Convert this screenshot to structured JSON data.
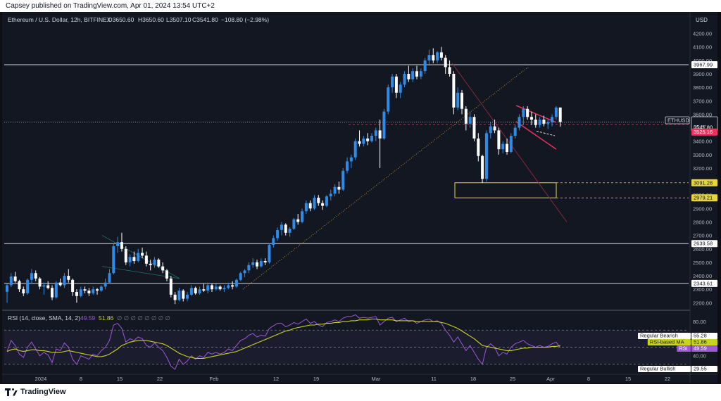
{
  "header": {
    "publisher": "Capsey published on TradingView.com, Apr 01, 2024 13:54 UTC+2"
  },
  "legend": {
    "symbol": "Ethereum / U.S. Dollar, 12h, BITFINEX",
    "open": "O3650.60",
    "high": "H3650.60",
    "low": "L3507.10",
    "close": "C3541.80",
    "change": "−108.80 (−2.98%)"
  },
  "price_axis": {
    "currency": "USD",
    "ticks": [
      "4200.00",
      "4100.00",
      "4000.00",
      "3900.00",
      "3800.00",
      "3700.00",
      "3600.00",
      "3500.00",
      "3400.00",
      "3300.00",
      "3200.00",
      "3100.00",
      "3000.00",
      "2900.00",
      "2800.00",
      "2700.00",
      "2600.00",
      "2500.00",
      "2400.00",
      "2300.00",
      "2200.00"
    ]
  },
  "price_labels": {
    "resistance_top": "3967.99",
    "ticker": "ETHUSD",
    "last_price": "3541.80",
    "countdown": "05:27",
    "red_level": "3525.16",
    "box_top": "3091.28",
    "box_bottom": "2979.21",
    "support_mid": "2639.58",
    "support_low": "2343.61"
  },
  "rsi": {
    "legend_prefix": "RSI (14, close, SMA, 14, 2)",
    "rsi_value": "49.59",
    "ma_value": "51.86",
    "nulls": "∅ ∅ ∅ ∅ ∅ ∅ ∅ ∅",
    "ticks": [
      "80.00",
      "40.00"
    ],
    "labels": {
      "bearish_name": "Regular Bearish",
      "bearish_value": "55.28",
      "ma_name": "RSI-based MA",
      "ma_value": "51.86",
      "rsi_name": "RSI",
      "rsi_value": "49.59",
      "bullish_name": "Regular Bullish",
      "bullish_value": "29.55"
    }
  },
  "time_axis": {
    "ticks": [
      "2024",
      "8",
      "15",
      "22",
      "Feb",
      "12",
      "19",
      "Mar",
      "11",
      "18",
      "25",
      "Apr",
      "8",
      "15",
      "22"
    ]
  },
  "footer": {
    "brand": "TradingView"
  },
  "colors": {
    "bull": "#2f8be6",
    "bear": "#ffffff",
    "rsi_line": "#9b59d6",
    "rsi_ma": "#c9d31f",
    "box": "#e7d53c",
    "red": "#e8335f",
    "bg": "#131722"
  },
  "chart_data": [
    {
      "type": "candlestick",
      "title": "Ethereum / U.S. Dollar, 12h, BITFINEX",
      "ylim": [
        2160,
        4250
      ],
      "yticks": [
        4200,
        4100,
        4000,
        3900,
        3800,
        3700,
        3600,
        3500,
        3400,
        3300,
        3200,
        3100,
        3000,
        2900,
        2800,
        2700,
        2600,
        2500,
        2400,
        2300,
        2200
      ],
      "levels": [
        3967.99,
        2639.58,
        2343.61
      ],
      "last_price": 3541.8,
      "red_level": 3525.16,
      "zone": [
        2979.21,
        3091.28
      ],
      "x_ticks": [
        "2024",
        "8",
        "15",
        "22",
        "Feb",
        "12",
        "19",
        "Mar",
        "11",
        "18",
        "25",
        "Apr",
        "8",
        "15",
        "22"
      ],
      "candles": [
        [
          2281,
          2340,
          2200,
          2330
        ],
        [
          2330,
          2420,
          2315,
          2395
        ],
        [
          2395,
          2430,
          2350,
          2360
        ],
        [
          2360,
          2370,
          2280,
          2300
        ],
        [
          2300,
          2320,
          2250,
          2270
        ],
        [
          2270,
          2380,
          2260,
          2370
        ],
        [
          2370,
          2450,
          2340,
          2420
        ],
        [
          2420,
          2440,
          2360,
          2380
        ],
        [
          2380,
          2390,
          2300,
          2320
        ],
        [
          2320,
          2350,
          2260,
          2330
        ],
        [
          2330,
          2360,
          2300,
          2310
        ],
        [
          2310,
          2330,
          2220,
          2240
        ],
        [
          2240,
          2360,
          2230,
          2350
        ],
        [
          2350,
          2380,
          2320,
          2330
        ],
        [
          2330,
          2420,
          2310,
          2400
        ],
        [
          2400,
          2450,
          2350,
          2370
        ],
        [
          2370,
          2380,
          2250,
          2280
        ],
        [
          2280,
          2300,
          2200,
          2250
        ],
        [
          2250,
          2320,
          2240,
          2300
        ],
        [
          2300,
          2320,
          2270,
          2290
        ],
        [
          2290,
          2310,
          2250,
          2270
        ],
        [
          2270,
          2320,
          2260,
          2300
        ],
        [
          2300,
          2310,
          2260,
          2290
        ],
        [
          2290,
          2330,
          2280,
          2320
        ],
        [
          2320,
          2380,
          2300,
          2350
        ],
        [
          2350,
          2450,
          2340,
          2420
        ],
        [
          2420,
          2640,
          2410,
          2620
        ],
        [
          2620,
          2690,
          2570,
          2650
        ],
        [
          2650,
          2720,
          2580,
          2600
        ],
        [
          2600,
          2620,
          2480,
          2500
        ],
        [
          2500,
          2560,
          2470,
          2540
        ],
        [
          2540,
          2580,
          2490,
          2510
        ],
        [
          2510,
          2600,
          2500,
          2570
        ],
        [
          2570,
          2610,
          2530,
          2550
        ],
        [
          2550,
          2580,
          2470,
          2490
        ],
        [
          2490,
          2520,
          2440,
          2480
        ],
        [
          2480,
          2540,
          2460,
          2520
        ],
        [
          2520,
          2530,
          2460,
          2470
        ],
        [
          2470,
          2500,
          2420,
          2440
        ],
        [
          2440,
          2450,
          2360,
          2380
        ],
        [
          2380,
          2400,
          2240,
          2260
        ],
        [
          2260,
          2280,
          2190,
          2220
        ],
        [
          2220,
          2310,
          2210,
          2290
        ],
        [
          2290,
          2300,
          2210,
          2230
        ],
        [
          2230,
          2280,
          2210,
          2260
        ],
        [
          2260,
          2330,
          2250,
          2310
        ],
        [
          2310,
          2320,
          2260,
          2270
        ],
        [
          2270,
          2320,
          2260,
          2300
        ],
        [
          2300,
          2340,
          2280,
          2290
        ],
        [
          2290,
          2350,
          2270,
          2330
        ],
        [
          2330,
          2340,
          2280,
          2300
        ],
        [
          2300,
          2340,
          2290,
          2320
        ],
        [
          2320,
          2330,
          2290,
          2300
        ],
        [
          2300,
          2330,
          2280,
          2310
        ],
        [
          2310,
          2350,
          2300,
          2330
        ],
        [
          2330,
          2360,
          2300,
          2320
        ],
        [
          2320,
          2380,
          2310,
          2370
        ],
        [
          2370,
          2430,
          2360,
          2420
        ],
        [
          2420,
          2450,
          2390,
          2440
        ],
        [
          2440,
          2500,
          2420,
          2480
        ],
        [
          2480,
          2530,
          2460,
          2500
        ],
        [
          2500,
          2520,
          2450,
          2470
        ],
        [
          2470,
          2530,
          2460,
          2510
        ],
        [
          2510,
          2530,
          2480,
          2500
        ],
        [
          2500,
          2640,
          2490,
          2630
        ],
        [
          2630,
          2700,
          2610,
          2680
        ],
        [
          2680,
          2760,
          2660,
          2740
        ],
        [
          2740,
          2800,
          2700,
          2780
        ],
        [
          2780,
          2790,
          2700,
          2720
        ],
        [
          2720,
          2760,
          2690,
          2750
        ],
        [
          2750,
          2830,
          2740,
          2820
        ],
        [
          2820,
          2860,
          2780,
          2800
        ],
        [
          2800,
          2900,
          2790,
          2880
        ],
        [
          2880,
          2960,
          2860,
          2940
        ],
        [
          2940,
          2960,
          2880,
          2900
        ],
        [
          2900,
          3000,
          2890,
          2980
        ],
        [
          2980,
          3000,
          2920,
          2940
        ],
        [
          2940,
          2960,
          2890,
          2920
        ],
        [
          2920,
          3000,
          2910,
          2990
        ],
        [
          2990,
          3040,
          2960,
          3010
        ],
        [
          3010,
          3080,
          2990,
          3060
        ],
        [
          3060,
          3100,
          3010,
          3040
        ],
        [
          3040,
          3200,
          3030,
          3180
        ],
        [
          3180,
          3280,
          3160,
          3250
        ],
        [
          3250,
          3300,
          3200,
          3280
        ],
        [
          3280,
          3420,
          3260,
          3400
        ],
        [
          3400,
          3480,
          3360,
          3380
        ],
        [
          3380,
          3440,
          3360,
          3420
        ],
        [
          3420,
          3460,
          3370,
          3400
        ],
        [
          3400,
          3460,
          3390,
          3440
        ],
        [
          3440,
          3500,
          3400,
          3480
        ],
        [
          3480,
          3560,
          3200,
          3420
        ],
        [
          3420,
          3640,
          3410,
          3620
        ],
        [
          3620,
          3820,
          3600,
          3800
        ],
        [
          3800,
          3900,
          3760,
          3880
        ],
        [
          3880,
          3900,
          3720,
          3760
        ],
        [
          3760,
          3840,
          3720,
          3820
        ],
        [
          3820,
          3920,
          3800,
          3900
        ],
        [
          3900,
          3960,
          3840,
          3860
        ],
        [
          3860,
          3940,
          3840,
          3920
        ],
        [
          3920,
          3960,
          3860,
          3880
        ],
        [
          3880,
          3940,
          3860,
          3920
        ],
        [
          3920,
          4020,
          3900,
          4000
        ],
        [
          4000,
          4080,
          3960,
          4040
        ],
        [
          4040,
          4090,
          3980,
          4000
        ],
        [
          4000,
          4070,
          3980,
          4060
        ],
        [
          4060,
          4100,
          4000,
          4020
        ],
        [
          4020,
          4040,
          3900,
          3950
        ],
        [
          3950,
          4000,
          3880,
          3900
        ],
        [
          3900,
          3920,
          3600,
          3650
        ],
        [
          3650,
          3800,
          3630,
          3760
        ],
        [
          3760,
          3780,
          3600,
          3640
        ],
        [
          3640,
          3660,
          3480,
          3530
        ],
        [
          3530,
          3620,
          3500,
          3580
        ],
        [
          3580,
          3600,
          3400,
          3420
        ],
        [
          3420,
          3460,
          3250,
          3290
        ],
        [
          3290,
          3300,
          3090,
          3120
        ],
        [
          3120,
          3480,
          3100,
          3460
        ],
        [
          3460,
          3540,
          3420,
          3510
        ],
        [
          3510,
          3560,
          3460,
          3480
        ],
        [
          3480,
          3500,
          3300,
          3340
        ],
        [
          3340,
          3400,
          3310,
          3380
        ],
        [
          3380,
          3420,
          3300,
          3320
        ],
        [
          3320,
          3460,
          3310,
          3440
        ],
        [
          3440,
          3520,
          3420,
          3500
        ],
        [
          3500,
          3600,
          3480,
          3580
        ],
        [
          3580,
          3660,
          3520,
          3640
        ],
        [
          3640,
          3660,
          3560,
          3580
        ],
        [
          3580,
          3620,
          3520,
          3560
        ],
        [
          3560,
          3600,
          3500,
          3520
        ],
        [
          3520,
          3580,
          3500,
          3560
        ],
        [
          3560,
          3590,
          3510,
          3530
        ],
        [
          3530,
          3560,
          3490,
          3540
        ],
        [
          3540,
          3600,
          3510,
          3580
        ],
        [
          3580,
          3660,
          3560,
          3650
        ],
        [
          3650,
          3650.6,
          3507.1,
          3541.8
        ]
      ]
    },
    {
      "type": "line",
      "title": "RSI (14, close, SMA, 14, 2)",
      "ylim": [
        20,
        90
      ],
      "yticks": [
        80,
        40
      ],
      "bands": [
        70,
        30
      ],
      "series": [
        {
          "name": "RSI",
          "values": [
            45,
            58,
            52,
            42,
            38,
            50,
            56,
            48,
            40,
            44,
            41,
            32,
            48,
            46,
            55,
            50,
            36,
            30,
            40,
            38,
            36,
            42,
            40,
            46,
            50,
            58,
            76,
            78,
            72,
            56,
            60,
            58,
            62,
            60,
            52,
            50,
            55,
            50,
            46,
            38,
            28,
            24,
            36,
            30,
            34,
            40,
            36,
            40,
            38,
            44,
            42,
            44,
            42,
            44,
            48,
            46,
            52,
            58,
            60,
            64,
            66,
            62,
            64,
            63,
            72,
            75,
            78,
            78,
            74,
            76,
            79,
            77,
            80,
            83,
            78,
            80,
            76,
            74,
            79,
            80,
            82,
            80,
            84,
            86,
            86,
            88,
            84,
            85,
            84,
            85,
            86,
            76,
            80,
            84,
            85,
            80,
            82,
            84,
            80,
            81,
            78,
            80,
            82,
            83,
            80,
            81,
            78,
            70,
            64,
            56,
            62,
            54,
            46,
            52,
            44,
            36,
            30,
            50,
            54,
            50,
            40,
            44,
            42,
            50,
            54,
            56,
            58,
            54,
            52,
            50,
            52,
            50,
            51,
            54,
            56,
            49.59
          ]
        },
        {
          "name": "RSI-based MA",
          "values": [
            45,
            47,
            48,
            46,
            45,
            46,
            47,
            47,
            46,
            46,
            45,
            44,
            44,
            44,
            45,
            46,
            45,
            44,
            43,
            42,
            41,
            40,
            39,
            39,
            40,
            42,
            45,
            48,
            52,
            54,
            56,
            57,
            58,
            58,
            58,
            57,
            56,
            55,
            54,
            52,
            49,
            46,
            43,
            41,
            39,
            38,
            37,
            37,
            37,
            38,
            39,
            40,
            41,
            42,
            43,
            44,
            45,
            47,
            49,
            51,
            53,
            55,
            57,
            59,
            61,
            63,
            65,
            67,
            69,
            70,
            72,
            73,
            74,
            75,
            76,
            76,
            77,
            77,
            78,
            78,
            79,
            79,
            80,
            80,
            81,
            81,
            82,
            82,
            82,
            83,
            83,
            82,
            82,
            82,
            82,
            81,
            81,
            81,
            81,
            81,
            80,
            80,
            80,
            80,
            80,
            80,
            79,
            78,
            76,
            74,
            72,
            69,
            66,
            63,
            60,
            56,
            52,
            51,
            50,
            49,
            48,
            47,
            46,
            46,
            47,
            48,
            49,
            49,
            50,
            50,
            50,
            50,
            50,
            51,
            51,
            51.86
          ]
        }
      ]
    }
  ]
}
